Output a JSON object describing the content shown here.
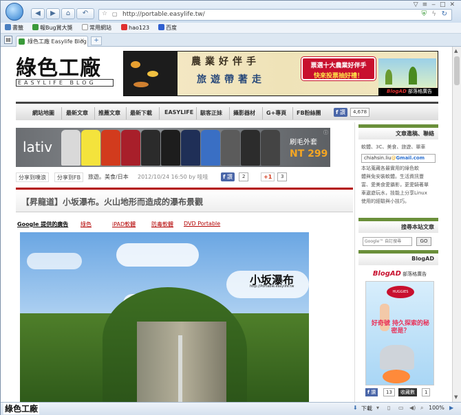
{
  "browser": {
    "url": "http://portable.easylife.tw/",
    "tab_title": "綠色工廠 Easylife Blog",
    "new_tab": "+",
    "bookmarks": [
      "書籤",
      "報Bug賞大獎",
      "常用網站",
      "hao123",
      "百度"
    ],
    "status": {
      "download": "下載",
      "zoom": "100%"
    }
  },
  "site": {
    "title": "綠色工廠",
    "subtitle": "EASYLIFE BLOG",
    "menu": [
      "網站地圖",
      "最新文章",
      "推薦文章",
      "最新下載",
      "EASYLIFE",
      "駭客正妹",
      "攝影器材",
      "G+專頁",
      "FB粉絲團"
    ],
    "fb_like": "讚",
    "fb_count": "4,678",
    "watermark": "綠色工廠"
  },
  "banner_ad": {
    "line1": "農業好伴手",
    "line2": "旅遊帶著走",
    "promo1": "票選十大農業好伴手",
    "promo2": "快來投票抽好禮！",
    "blogad": "BlogAD",
    "blogad_label": "部落格廣告"
  },
  "lativ_ad": {
    "brand": "lativ",
    "product": "刷毛外套",
    "price": "NT 299",
    "jacket_colors": [
      "#d9d9d9",
      "#f4e33c",
      "#d23b1d",
      "#a81f2a",
      "#2b2b2b",
      "#1d1d1d",
      "#1f2f57",
      "#3a6fc4",
      "#5b5b5b",
      "#2c2c2c",
      "#444"
    ]
  },
  "share": {
    "plurk": "分享到噗浪",
    "fb": "分享到FB",
    "category": "旅遊。美食/日本",
    "date": "2012/10/24 16:50",
    "by": "by",
    "author": "哇哇",
    "like": "讚",
    "like_count": "2",
    "plus1": "+1",
    "plus_count": "3"
  },
  "article": {
    "title": "【昇龍道】小坂瀑布。火山地形而造成的瀑布景觀",
    "ad_label": "Google 提供的廣告",
    "ad_links": [
      "綠色",
      "iPAD軟體",
      "防毒軟體",
      "DVD Portable"
    ],
    "photo_caption": "小坂瀑布",
    "photo_url": "http://Portable.easylife.tw"
  },
  "sidebar": {
    "contact_title": "文章邀稿、聯絡",
    "contact_text": "軟體、3C、美食、旅遊、單車",
    "email": "chiahsin.liu",
    "gmail": "Gmail.com",
    "about": [
      "本站蒐藏各最實用的綠色軟",
      "體與免安裝軟體。生活資訊豐",
      "富、愛美食愛攝影，更愛騎著單",
      "車遨遊玩水，技能上分享Linux",
      "使用的經驗與小技巧。"
    ],
    "search_title": "搜尋本站文章",
    "search_placeholder": "Google™ 自訂搜尋",
    "search_button": "GO",
    "blogad_title": "BlogAD",
    "blogad_brand": "BlogAD",
    "blogad_label": "部落格廣告",
    "ad_text": "好奇號 持久探索的秘密是？",
    "huggies": "HUGGIES",
    "fb_like": "讚",
    "fb_count": "13",
    "collect": "收藏數",
    "collect_count": "1"
  }
}
